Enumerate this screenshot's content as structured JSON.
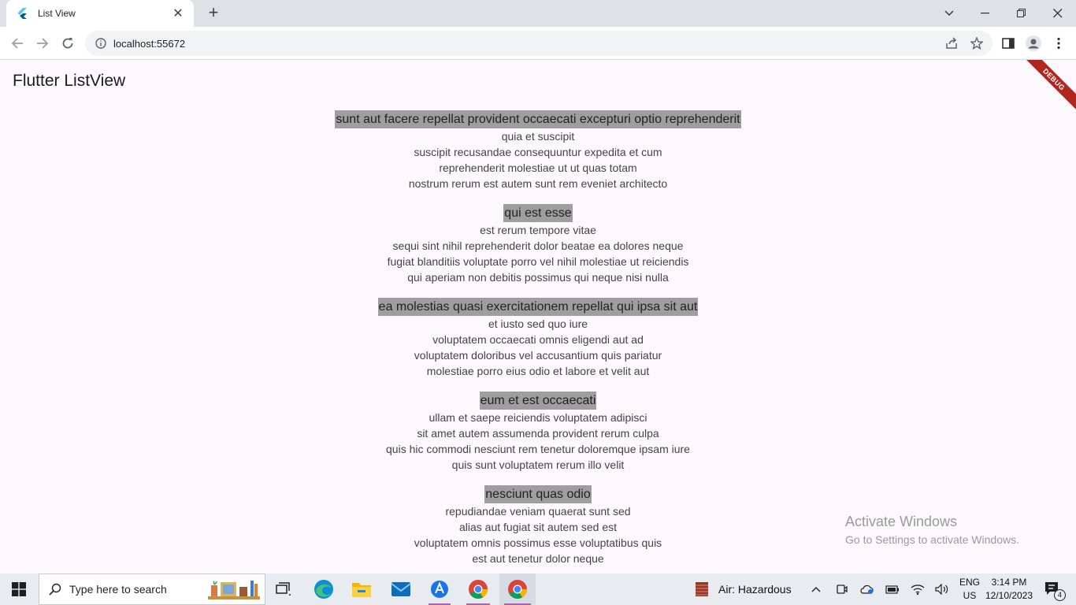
{
  "browser": {
    "tab_title": "List View",
    "new_tab": "+",
    "url": "localhost:55672"
  },
  "page": {
    "app_title": "Flutter ListView",
    "debug_banner": "DEBUG"
  },
  "posts": [
    {
      "title": "sunt aut facere repellat provident occaecati excepturi optio reprehenderit",
      "body": [
        "quia et suscipit",
        "suscipit recusandae consequuntur expedita et cum",
        "reprehenderit molestiae ut ut quas totam",
        "nostrum rerum est autem sunt rem eveniet architecto"
      ]
    },
    {
      "title": "qui est esse",
      "body": [
        "est rerum tempore vitae",
        "sequi sint nihil reprehenderit dolor beatae ea dolores neque",
        "fugiat blanditiis voluptate porro vel nihil molestiae ut reiciendis",
        "qui aperiam non debitis possimus qui neque nisi nulla"
      ]
    },
    {
      "title": "ea molestias quasi exercitationem repellat qui ipsa sit aut",
      "body": [
        "et iusto sed quo iure",
        "voluptatem occaecati omnis eligendi aut ad",
        "voluptatem doloribus vel accusantium quis pariatur",
        "molestiae porro eius odio et labore et velit aut"
      ]
    },
    {
      "title": "eum et est occaecati",
      "body": [
        "ullam et saepe reiciendis voluptatem adipisci",
        "sit amet autem assumenda provident rerum culpa",
        "quis hic commodi nesciunt rem tenetur doloremque ipsam iure",
        "quis sunt voluptatem rerum illo velit"
      ]
    },
    {
      "title": "nesciunt quas odio",
      "body": [
        "repudiandae veniam quaerat sunt sed",
        "alias aut fugiat sit autem sed est",
        "voluptatem omnis possimus esse voluptatibus quis",
        "est aut tenetur dolor neque"
      ]
    }
  ],
  "watermark": {
    "line1": "Activate Windows",
    "line2": "Go to Settings to activate Windows."
  },
  "taskbar": {
    "search_placeholder": "Type here to search",
    "weather": "Air: Hazardous",
    "lang_top": "ENG",
    "lang_bottom": "US",
    "time": "3:14 PM",
    "date": "12/10/2023",
    "notification_count": "4"
  },
  "colors": {
    "title_highlight": "#9e9e9e",
    "page_bg": "#fdf7fe",
    "debug": "#b3261e"
  }
}
